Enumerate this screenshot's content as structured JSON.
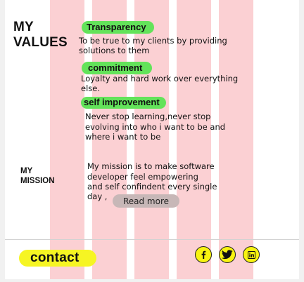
{
  "values": {
    "heading_line1": "MY",
    "heading_line2": "VALUES",
    "items": [
      {
        "tag": "Transparency",
        "lines": [
          "To be true  to my clients by providing",
          "solutions to them"
        ]
      },
      {
        "tag": "commitment",
        "lines": [
          "Loyalty and hard work over everything",
          "else."
        ]
      },
      {
        "tag": "self improvement",
        "lines": [
          "Never stop learning,never stop",
          "evolving into who i want to be and",
          "where i want to be"
        ]
      }
    ]
  },
  "mission": {
    "heading_line1": "MY",
    "heading_line2": "MISSION",
    "lines": [
      "My mission is to make software",
      "developer feel empowering",
      "and self confindent every single",
      "day ,"
    ],
    "read_more_label": "Read more"
  },
  "footer": {
    "contact_label": "contact",
    "social_icons": [
      "facebook-icon",
      "twitter-icon",
      "linkedin-icon"
    ]
  },
  "colors": {
    "stripe": "#fbd0d3",
    "tag_green": "#63e35a",
    "contact_yellow": "#f6f523",
    "read_more_bg": "#c7b7b7"
  }
}
